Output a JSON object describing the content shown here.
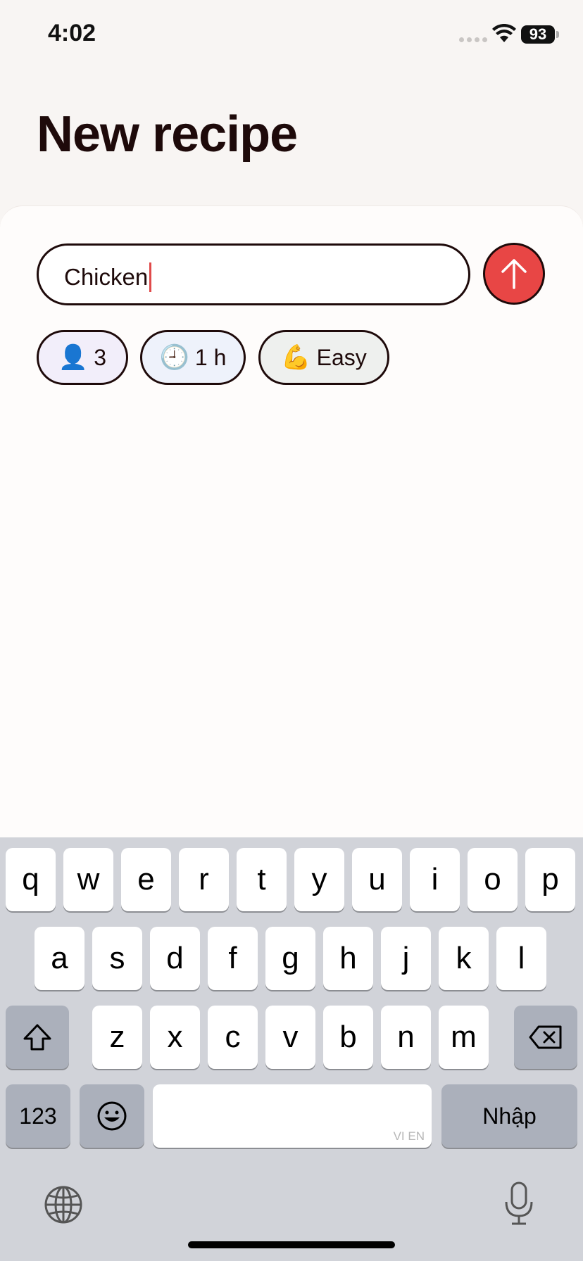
{
  "status": {
    "time": "4:02",
    "battery": "93"
  },
  "page": {
    "title": "New recipe"
  },
  "composer": {
    "input_value": "Chicken"
  },
  "chips": {
    "servings": {
      "emoji": "👤",
      "label": "3"
    },
    "time": {
      "emoji": "🕘",
      "label": "1 h"
    },
    "difficulty": {
      "emoji": "💪",
      "label": "Easy"
    }
  },
  "colors": {
    "accent": "#e84645",
    "ink": "#1e0a0a",
    "background": "#f8f5f3"
  },
  "keyboard": {
    "row1": [
      "q",
      "w",
      "e",
      "r",
      "t",
      "y",
      "u",
      "i",
      "o",
      "p"
    ],
    "row2": [
      "a",
      "s",
      "d",
      "f",
      "g",
      "h",
      "j",
      "k",
      "l"
    ],
    "row3": [
      "z",
      "x",
      "c",
      "v",
      "b",
      "n",
      "m"
    ],
    "numbers_label": "123",
    "return_label": "Nhập",
    "space_lang": "VI EN"
  }
}
